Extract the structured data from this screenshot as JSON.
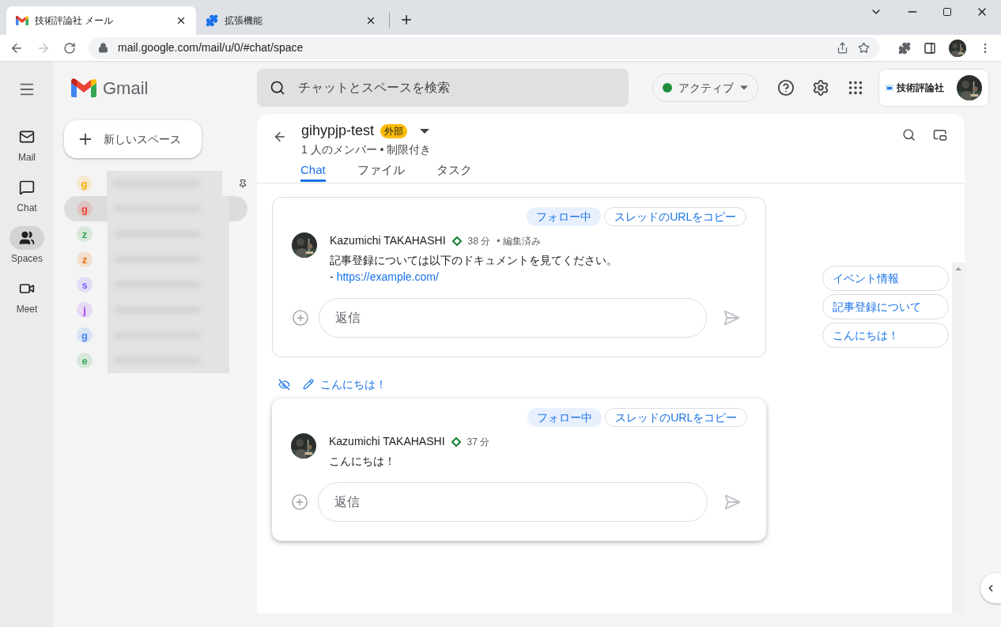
{
  "browser": {
    "tabs": [
      {
        "title": "技術評論社 メール",
        "kind": "gmail",
        "selected": true
      },
      {
        "title": "拡張機能",
        "kind": "extension",
        "selected": false
      }
    ],
    "url": "mail.google.com/mail/u/0/#chat/space"
  },
  "gmail": {
    "logo": "Gmail",
    "search_placeholder": "チャットとスペースを検索",
    "status": "アクティブ",
    "org": "技術評論社"
  },
  "rail": [
    {
      "label": "Mail",
      "kind": "mail",
      "selected": false
    },
    {
      "label": "Chat",
      "kind": "chat",
      "selected": false
    },
    {
      "label": "Spaces",
      "kind": "spaces",
      "selected": true
    },
    {
      "label": "Meet",
      "kind": "meet",
      "selected": false
    }
  ],
  "new_space": "新しいスペース",
  "spaces": [
    {
      "initial": "g",
      "color": "#f9ab00",
      "selected": false,
      "pinned": true
    },
    {
      "initial": "g",
      "color": "#ea4335",
      "selected": true,
      "pinned": false
    },
    {
      "initial": "z",
      "color": "#34a853",
      "selected": false,
      "pinned": false
    },
    {
      "initial": "z",
      "color": "#e8710a",
      "selected": false,
      "pinned": false
    },
    {
      "initial": "s",
      "color": "#7b61ff",
      "selected": false,
      "pinned": false
    },
    {
      "initial": "j",
      "color": "#a142f4",
      "selected": false,
      "pinned": false
    },
    {
      "initial": "g",
      "color": "#4285f4",
      "selected": false,
      "pinned": false
    },
    {
      "initial": "e",
      "color": "#34a853",
      "selected": false,
      "pinned": false
    }
  ],
  "space": {
    "name": "gihypjp-test",
    "badge": "外部",
    "subtitle": "1 人のメンバー • 制限付き",
    "tabs": [
      {
        "label": "Chat",
        "selected": true
      },
      {
        "label": "ファイル",
        "selected": false
      },
      {
        "label": "タスク",
        "selected": false
      }
    ]
  },
  "threads": [
    {
      "highlighted": false,
      "follow": "フォロー中",
      "following": true,
      "copy": "スレッドのURLをコピー",
      "message": {
        "author": "Kazumichi TAKAHASHI",
        "time": "38 分",
        "edited_separator": "•",
        "edited": "編集済み",
        "body": "記事登録については以下のドキュメントを見てください。",
        "link_prefix": "-",
        "link": "https://example.com/"
      },
      "reply_placeholder": "返信"
    },
    {
      "title": "こんにちは！",
      "highlighted": true,
      "follow": "フォロー中",
      "following": true,
      "copy": "スレッドのURLをコピー",
      "message": {
        "author": "Kazumichi TAKAHASHI",
        "time": "37 分",
        "body": "こんにちは！"
      },
      "reply_placeholder": "返信"
    }
  ],
  "thread_nav": [
    "イベント情報",
    "記事登録について",
    "こんにちは！"
  ]
}
